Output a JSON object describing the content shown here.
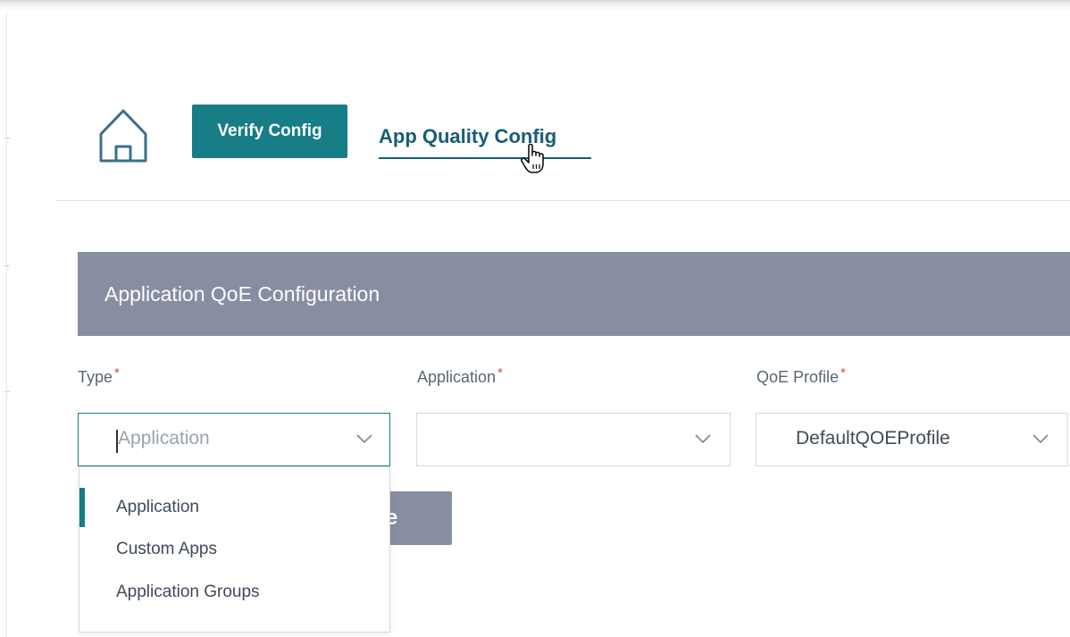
{
  "nav": {
    "home_icon": "home-icon",
    "verify_label": "Verify Config",
    "active_tab_label": "App Quality Config"
  },
  "section": {
    "title": "Application QoE Configuration"
  },
  "form": {
    "type": {
      "label": "Type",
      "required_mark": "*",
      "placeholder": "Application"
    },
    "application": {
      "label": "Application",
      "required_mark": "*",
      "value": ""
    },
    "qoe_profile": {
      "label": "QoE Profile",
      "required_mark": "*",
      "value": "DefaultQOEProfile"
    }
  },
  "partially_hidden_button": {
    "visible_text": "e"
  },
  "type_dropdown": {
    "options": [
      "Application",
      "Custom Apps",
      "Application Groups"
    ],
    "highlighted_index": 0
  },
  "colors": {
    "accent": "#177d86",
    "section_header": "#888ea1",
    "tab_text": "#175e75",
    "required": "#e3443c"
  }
}
